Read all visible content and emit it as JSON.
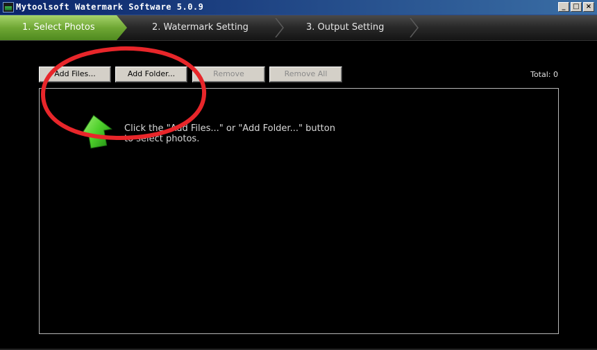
{
  "window": {
    "title": "Mytoolsoft Watermark Software 5.0.9",
    "controls": [
      "_",
      "□",
      "×"
    ]
  },
  "steps": [
    {
      "label": "1. Select Photos",
      "active": true
    },
    {
      "label": "2. Watermark Setting",
      "active": false
    },
    {
      "label": "3. Output Setting",
      "active": false
    }
  ],
  "toolbar": {
    "add_files": "Add Files...",
    "add_folder": "Add Folder...",
    "remove": "Remove",
    "remove_all": "Remove All",
    "total": "Total: 0"
  },
  "panel": {
    "hint_line1": "Click the \"Add Files...\" or \"Add Folder...\" button",
    "hint_line2": "to select photos."
  },
  "colors": {
    "active_step": "#6fa734",
    "annotation": "#e8262a",
    "arrow": "#4fd12c"
  },
  "icons": {
    "app": "watermark-app-icon",
    "hint": "green-up-left-arrow-icon"
  }
}
